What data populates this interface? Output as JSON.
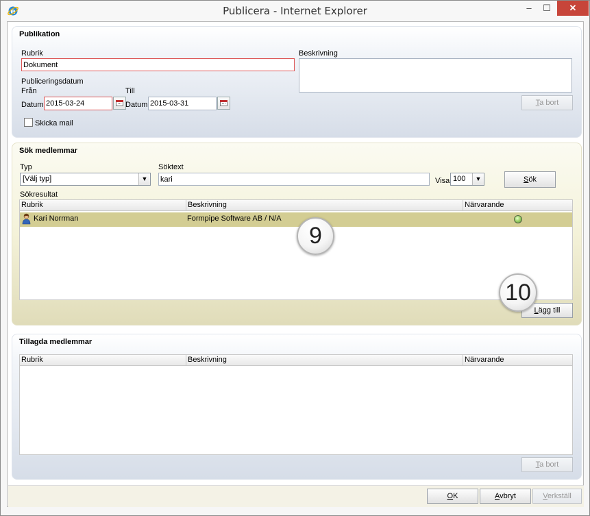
{
  "window": {
    "title": "Publicera - Internet Explorer",
    "min_glyph": "–",
    "max_glyph": "☐",
    "close_glyph": "✕"
  },
  "publikation": {
    "section_title": "Publikation",
    "rubrik_label": "Rubrik",
    "rubrik_value": "Dokument",
    "beskrivning_label": "Beskrivning",
    "beskrivning_value": "",
    "publiceringsdatum_label": "Publiceringsdatum",
    "fran_label": "Från",
    "till_label": "Till",
    "datum_label": "Datum",
    "fran_datum": "2015-03-24",
    "till_datum": "2015-03-31",
    "skicka_mail_label": "Skicka mail",
    "skicka_mail_checked": false,
    "ta_bort_label_ul": "T",
    "ta_bort_label_rest": "a bort"
  },
  "sok": {
    "section_title": "Sök medlemmar",
    "typ_label": "Typ",
    "typ_selected": "[Välj typ]",
    "soktext_label": "Söktext",
    "soktext_value": "kari",
    "visa_label": "Visa",
    "visa_selected": "100",
    "sok_button_ul": "S",
    "sok_button_rest": "ök",
    "sokresultat_label": "Sökresultat",
    "columns": [
      "Rubrik",
      "Beskrivning",
      "Närvarande"
    ],
    "rows": [
      {
        "rubrik": "Kari Norrman",
        "beskrivning": "Formpipe Software AB / N/A",
        "narvarande": "present"
      }
    ],
    "lagg_till_ul": "L",
    "lagg_till_rest": "ägg till"
  },
  "tillagda": {
    "section_title": "Tillagda medlemmar",
    "columns": [
      "Rubrik",
      "Beskrivning",
      "Närvarande"
    ],
    "rows": [],
    "ta_bort_ul": "T",
    "ta_bort_rest": "a bort"
  },
  "footer": {
    "ok_ul": "O",
    "ok_rest": "K",
    "avbryt_ul": "A",
    "avbryt_rest": "vbryt",
    "verkstall_ul": "V",
    "verkstall_rest": "erkställ"
  },
  "callouts": {
    "nine": "9",
    "ten": "10"
  },
  "colors": {
    "highlight_row": "#d3cd93",
    "invalid_border": "#dd5555",
    "close_button": "#c7453a"
  }
}
